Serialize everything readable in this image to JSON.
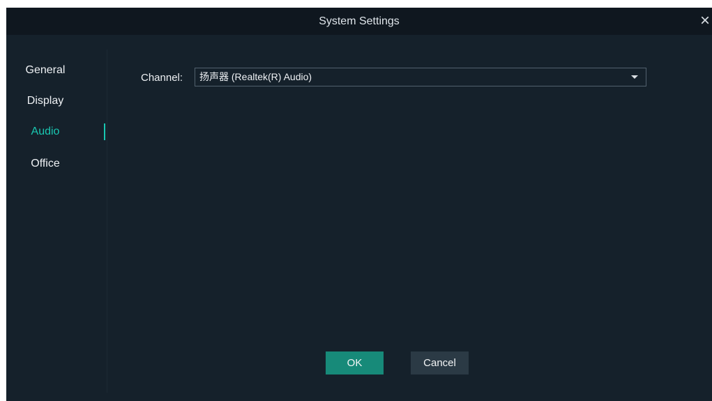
{
  "window": {
    "title": "System Settings",
    "close_label": "×"
  },
  "sidebar": {
    "items": [
      {
        "label": "General"
      },
      {
        "label": "Display"
      },
      {
        "label": "Audio"
      },
      {
        "label": "Office"
      }
    ]
  },
  "audio": {
    "channel_label": "Channel:",
    "channel_value": "扬声器 (Realtek(R) Audio)"
  },
  "footer": {
    "ok_label": "OK",
    "cancel_label": "Cancel"
  },
  "colors": {
    "accent": "#19c7b1",
    "ok_button": "#178a79",
    "dialog_background": "#15212b",
    "titlebar_background": "#0f171f"
  },
  "icons": {
    "close": "close-icon",
    "dropdown": "chevron-down-icon"
  }
}
